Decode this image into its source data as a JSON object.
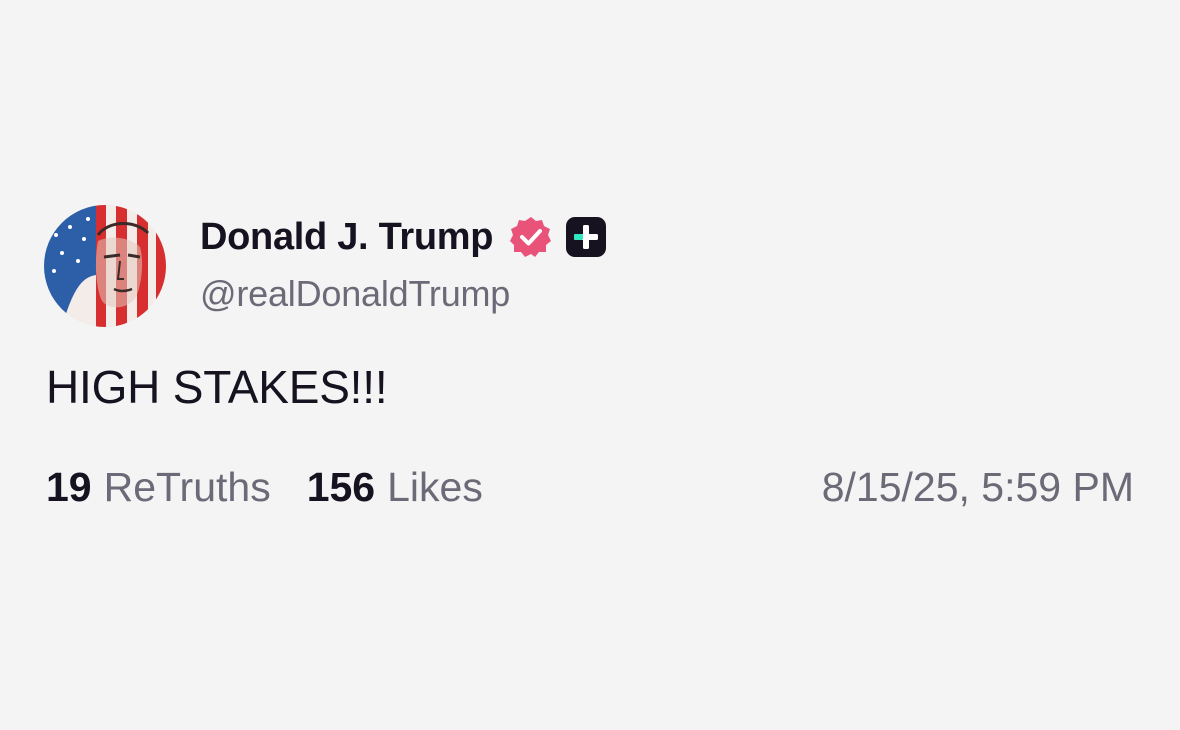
{
  "post": {
    "author": {
      "display_name": "Donald J. Trump",
      "handle": "@realDonaldTrump"
    },
    "body": "HIGH STAKES!!!",
    "stats": {
      "retruths_count": "19",
      "retruths_label": "ReTruths",
      "likes_count": "156",
      "likes_label": "Likes"
    },
    "timestamp": "8/15/25, 5:59 PM"
  },
  "icons": {
    "verified": "verified-badge-icon",
    "subscription": "plus-badge-icon"
  },
  "colors": {
    "background": "#f4f4f5",
    "text_primary": "#16121f",
    "text_secondary": "#6d6a78",
    "verified_badge": "#e9537a",
    "plus_badge": "#16121f",
    "plus_accent": "#2ee6c0"
  }
}
